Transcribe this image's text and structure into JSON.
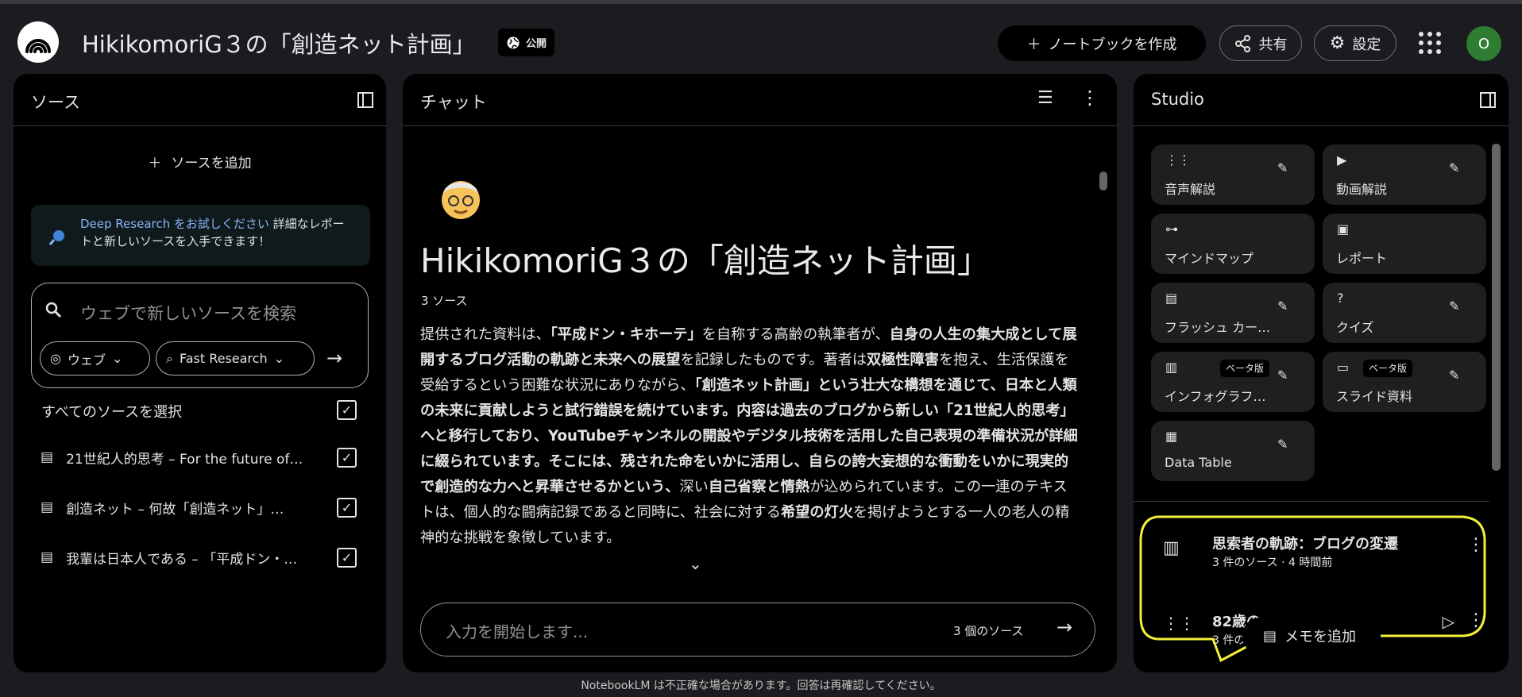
{
  "header": {
    "title": "HikikomoriG３の「創造ネット計画」",
    "public_label": "公開",
    "create_label": "ノートブックを作成",
    "share_label": "共有",
    "settings_label": "設定",
    "avatar_initial": "O"
  },
  "sources": {
    "title": "ソース",
    "add_label": "ソースを追加",
    "deep_link": "Deep Research をお試しください",
    "deep_text": " 詳細なレポートと新しいソースを入手できます！",
    "search_placeholder": "ウェブで新しいソースを検索",
    "web_label": "ウェブ",
    "fast_label": "Fast Research",
    "select_all": "すべてのソースを選択",
    "items": [
      "21世紀人的思考 – For the future of…",
      "創造ネット – 何故「創造ネット」…",
      "我輩は日本人である – 「平成ドン・…"
    ]
  },
  "chat": {
    "title": "チャット",
    "notebook_title": "HikikomoriG３の「創造ネット計画」",
    "source_count": "3 ソース",
    "summary_parts": [
      {
        "text": "提供された資料は、"
      },
      {
        "text": "「平成ドン・キホーテ」",
        "bold": true
      },
      {
        "text": "を自称する高齢の執筆者が、"
      },
      {
        "text": "自身の人生の集大成として展開するブログ活動の軌跡と未来への展望",
        "bold": true
      },
      {
        "text": "を記録したものです。著者は"
      },
      {
        "text": "双極性障害",
        "bold": true
      },
      {
        "text": "を抱え、生活保護を受給するという困難な状況にありながら、"
      },
      {
        "text": "「創造ネット計画」という壮大な構想を通じて、日本と人類の未来に貢献しようと試行錯誤を続けています。内容は過去のブログから新しい「21世紀人的思考」へと移行しており、YouTubeチャンネルの開設やデジタル技術を活用した自己表現の準備状況が詳細に綴られています。そこには、残された命をいかに活用し、自らの誇大妄想的な衝動をいかに現実的で創造的な力へと昇華させるかという、",
        "bold": true
      },
      {
        "text": "深い"
      },
      {
        "text": "自己省察と情熱",
        "bold": true
      },
      {
        "text": "が込められています。この一連のテキストは、個人的な闘病記録であると同時に、社会に対する"
      },
      {
        "text": "希望の灯火",
        "bold": true
      },
      {
        "text": "を掲げようとする一人の老人の精神的な挑戦を象徴しています。"
      }
    ],
    "input_placeholder": "入力を開始します...",
    "input_source_count": "3 個のソース"
  },
  "studio": {
    "title": "Studio",
    "beta": "ベータ版",
    "tiles": [
      "音声解説",
      "動画解説",
      "マインドマップ",
      "レポート",
      "フラッシュ カー…",
      "クイズ",
      "インフォグラフ…",
      "スライド資料",
      "Data Table"
    ],
    "notes": [
      {
        "title": "思索者の軌跡：ブログの変遷",
        "meta": "3 件のソース · 4 時間前"
      },
      {
        "title": "82歳の",
        "meta": "3 件の"
      }
    ],
    "memo_label": "メモを追加"
  },
  "footer": {
    "disclaimer": "NotebookLM は不正確な場合があります。回答は再確認してください。"
  },
  "colors": {
    "highlight": "#f3f03a",
    "link": "#8ab4f8",
    "avatar": "#2f7d32"
  }
}
